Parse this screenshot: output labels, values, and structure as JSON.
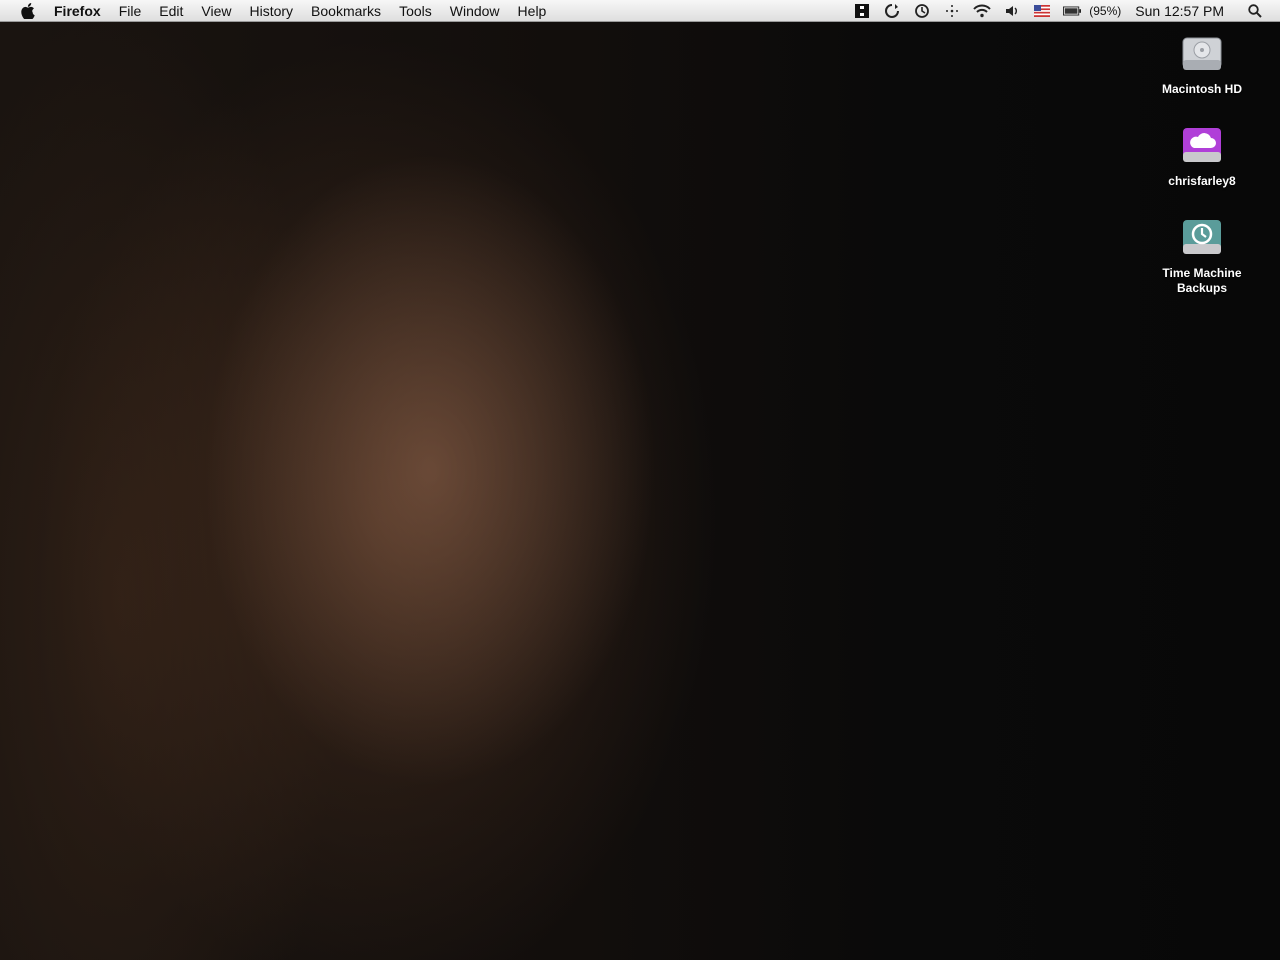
{
  "menubar": {
    "app_name": "Firefox",
    "items": [
      "File",
      "Edit",
      "View",
      "History",
      "Bookmarks",
      "Tools",
      "Window",
      "Help"
    ],
    "battery_percent": "(95%)",
    "clock": "Sun 12:57 PM"
  },
  "desktop_icons": [
    {
      "label": "Macintosh HD",
      "icon": "hard-drive-icon"
    },
    {
      "label": "chrisfarley8",
      "icon": "icloud-drive-icon",
      "color": "#b03fd8"
    },
    {
      "label": "Time Machine Backups",
      "icon": "time-machine-drive-icon",
      "color": "#5a9c9a"
    }
  ]
}
